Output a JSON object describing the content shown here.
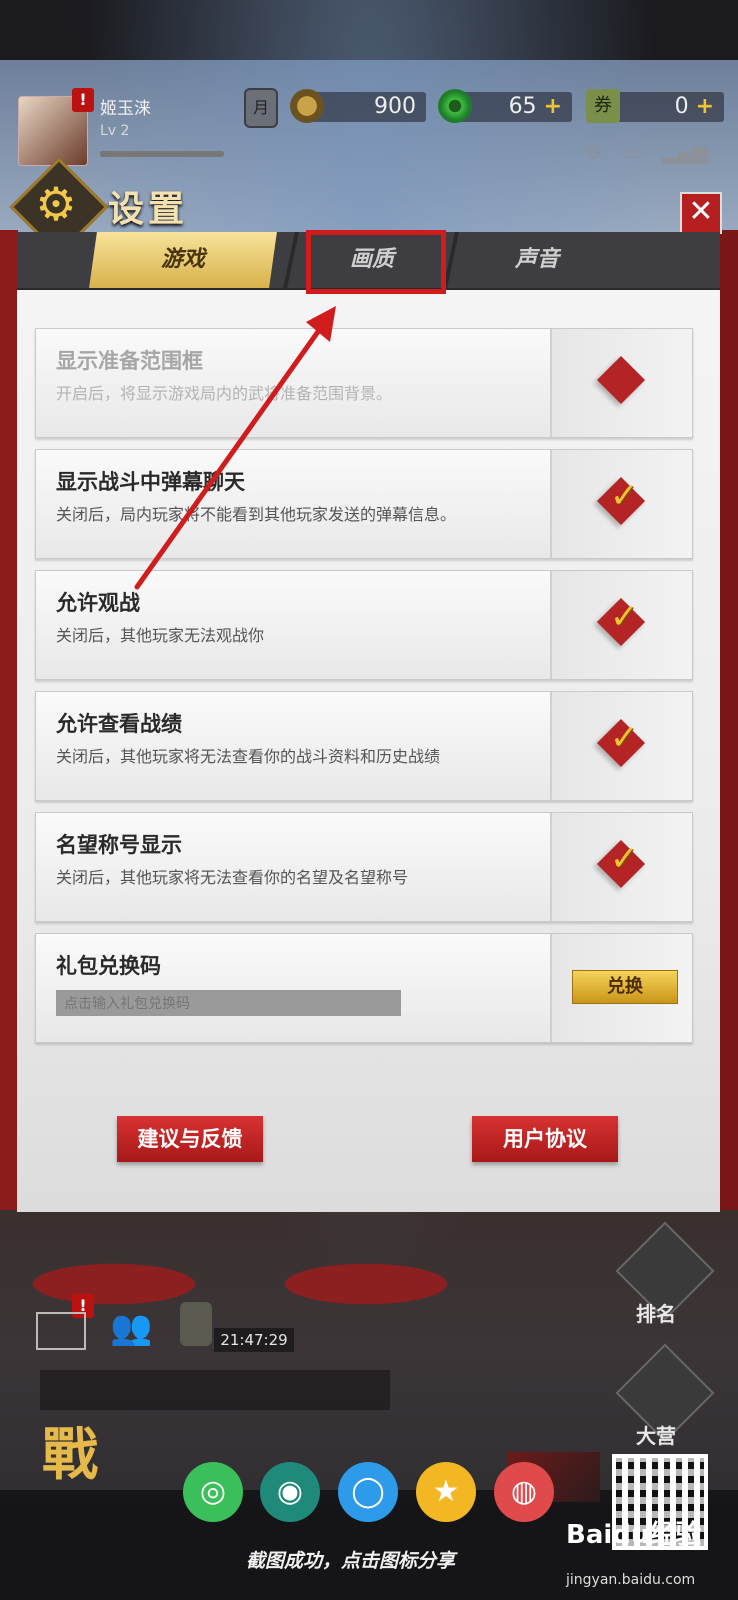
{
  "hud": {
    "player_name": "姬玉涞",
    "level": "Lv 2",
    "moon_label": "月",
    "coins": "900",
    "jade": "65",
    "tickets_label": "券",
    "tickets": "0",
    "plus": "+",
    "alert": "!"
  },
  "header": {
    "title": "设置",
    "close_glyph": "✕"
  },
  "tabs": [
    {
      "label": "游戏",
      "active": true
    },
    {
      "label": "画质",
      "active": false
    },
    {
      "label": "声音",
      "active": false
    }
  ],
  "settings": [
    {
      "title": "显示准备范围框",
      "desc": "开启后，将显示游戏局内的武将准备范围背景。",
      "checked": false,
      "disabled": true
    },
    {
      "title": "显示战斗中弹幕聊天",
      "desc": "关闭后，局内玩家将不能看到其他玩家发送的弹幕信息。",
      "checked": true,
      "disabled": false
    },
    {
      "title": "允许观战",
      "desc": "关闭后，其他玩家无法观战你",
      "checked": true,
      "disabled": false
    },
    {
      "title": "允许查看战绩",
      "desc": "关闭后，其他玩家将无法查看你的战斗资料和历史战绩",
      "checked": true,
      "disabled": false
    },
    {
      "title": "名望称号显示",
      "desc": "关闭后，其他玩家将无法查看你的名望及名望称号",
      "checked": true,
      "disabled": false
    }
  ],
  "redeem": {
    "title": "礼包兑换码",
    "placeholder": "点击输入礼包兑换码",
    "button": "兑换"
  },
  "footer": {
    "feedback": "建议与反馈",
    "agreement": "用户协议"
  },
  "lower_hud": {
    "clock": "21:47:29",
    "rank": "排名",
    "camp": "大营",
    "logo_text": "戰"
  },
  "share": {
    "caption": "截图成功，点击图标分享",
    "watermark": "Baidu经验",
    "url": "jingyan.baidu.com"
  },
  "colors": {
    "accent_red": "#b52424",
    "tab_gold": "#d8b24c",
    "check_gold": "#f2c230",
    "annotation_red": "#d01c1c"
  }
}
